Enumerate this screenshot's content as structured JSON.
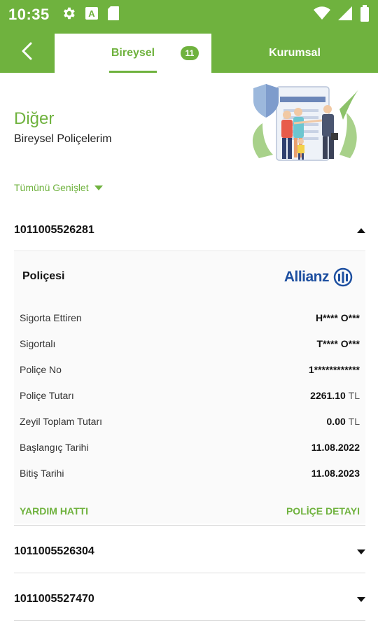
{
  "status_bar": {
    "time": "10:35",
    "icons": [
      "gear-icon",
      "a-box-icon",
      "sim-card-icon",
      "wifi-icon",
      "signal-icon",
      "battery-icon"
    ]
  },
  "tabs": {
    "individual": {
      "label": "Bireysel",
      "count": "11"
    },
    "corporate": {
      "label": "Kurumsal"
    }
  },
  "header": {
    "title": "Diğer",
    "subtitle": "Bireysel Poliçelerim"
  },
  "expand_all_label": "Tümünü Genişlet",
  "policies": [
    {
      "number": "1011005526281",
      "expanded": true
    },
    {
      "number": "1011005526304",
      "expanded": false
    },
    {
      "number": "1011005527470",
      "expanded": false
    }
  ],
  "detail": {
    "title": "Poliçesi",
    "brand": "Allianz",
    "rows": [
      {
        "label": "Sigorta Ettiren",
        "value": "H**** O***",
        "unit": ""
      },
      {
        "label": "Sigortalı",
        "value": "T**** O***",
        "unit": ""
      },
      {
        "label": "Poliçe No",
        "value": "1************",
        "unit": ""
      },
      {
        "label": "Poliçe Tutarı",
        "value": "2261.10",
        "unit": "TL"
      },
      {
        "label": "Zeyil Toplam Tutarı",
        "value": "0.00",
        "unit": "TL"
      },
      {
        "label": "Başlangıç Tarihi",
        "value": "11.08.2022",
        "unit": ""
      },
      {
        "label": "Bitiş Tarihi",
        "value": "11.08.2023",
        "unit": ""
      }
    ],
    "helpline_label": "YARDIM HATTI",
    "policy_detail_label": "POLİÇE DETAYI"
  },
  "colors": {
    "accent": "#6fb23e",
    "brand_blue": "#1d4fa0"
  }
}
